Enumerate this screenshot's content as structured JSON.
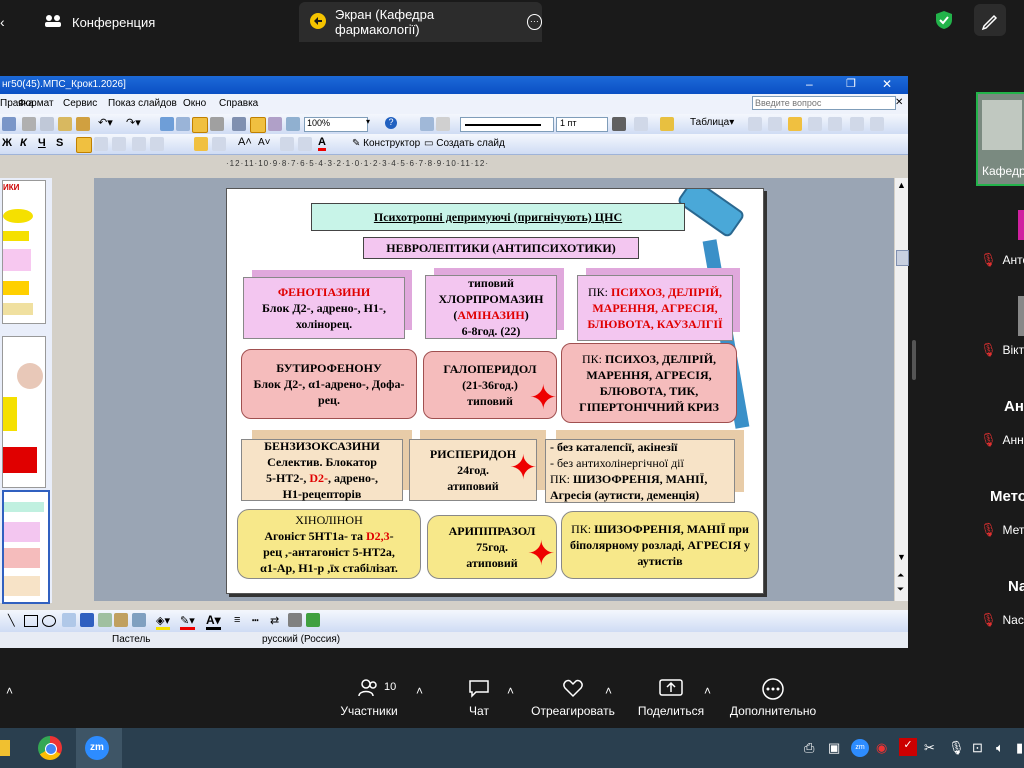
{
  "zoom_top": {
    "conference_tab": "Конференция",
    "screen_tab": "Экран (Кафедра фармакології)"
  },
  "ppt": {
    "title": "нг50(45).МПС_Крок1.2026]",
    "menu": [
      "Правка",
      "Формат",
      "Сервис",
      "Показ слайдов",
      "Окно",
      "Справка"
    ],
    "help_placeholder": "Введите вопрос",
    "zoom_value": "100%",
    "line_width": "1 пт",
    "table_label": "Таблица",
    "designer_label": "Конструктор",
    "new_slide_label": "Создать слайд",
    "ruler": "·12·11·10·9·8·7·6·5·4·3·2·1·0·1·2·3·4·5·6·7·8·9·10·11·12·",
    "status_theme": "Пастель",
    "status_lang": "русский (Россия)"
  },
  "slide": {
    "title": "Психотропні депримуючі (пригнічують) ЦНС",
    "subtitle": "НЕВРОЛЕПТИКИ (АНТИПСИХОТИКИ)",
    "phenothiazines": {
      "name": "ФЕНОТІАЗИНИ",
      "desc": "Блок Д2-, адрено-, Н1-, холінорец."
    },
    "chlorpromazine": {
      "type": "типовий",
      "name": "ХЛОРПРОМАЗИН",
      "alias": "АМІНАЗИН",
      "dose": "6-8год. (22)"
    },
    "pk1": {
      "label": "ПК:",
      "text": "ПСИХОЗ, ДЕЛІРІЙ, МАРЕННЯ, АГРЕСІЯ, БЛЮВОТА, КАУЗАЛГІЇ"
    },
    "butyrophenone": {
      "name": "БУТИРОФЕНОНУ",
      "desc": "Блок Д2-, α1-адрено-, Дофа-рец."
    },
    "haloperidol": {
      "name": "ГАЛОПЕРИДОЛ",
      "dose": "(21-36год.)",
      "type": "типовий"
    },
    "pk2": {
      "label": "ПК:",
      "text": "ПСИХОЗ, ДЕЛІРІЙ, МАРЕННЯ, АГРЕСІЯ, БЛЮВОТА, ТИК, ГІПЕРТОНІЧНИЙ КРИЗ"
    },
    "benzisoxazines": {
      "name": "БЕНЗИЗОКСАЗИНИ",
      "desc1": "Селектив. Блокатор",
      "desc2": "5-НТ2-,",
      "desc2_red": "D2-",
      "desc2_end": ", адрено-,",
      "desc3": "Н1-рецепторів"
    },
    "risperidone": {
      "name": "РИСПЕРИДОН",
      "dose": "24год.",
      "type": "атиповий"
    },
    "pk3": {
      "line1": "- без каталепсії, акінезії",
      "line2": "- без антихолінергічної дії",
      "label": "ПК:",
      "text": "ШИЗОФРЕНІЯ, МАНІЇ,",
      "line4": "Агресія (аутисти, деменція)"
    },
    "quinolinone": {
      "name": "ХІНОЛІНОН",
      "desc1": "Агоніст 5НТ1а- та",
      "desc1_red": "D2,3",
      "desc1_end": "-",
      "desc2": "рец ,-антагоніст 5-НТ2а,",
      "desc3": "α1-Ар, Н1-р ,їх стабілізат."
    },
    "aripiprazole": {
      "name": "АРИПІПРАЗОЛ",
      "dose": "75год.",
      "type": "атиповий"
    },
    "pk4": {
      "label": "ПК:",
      "text": "ШИЗОФРЕНІЯ, МАНІЇ при біполярному розладі, АГРЕСІЯ у аутистів"
    }
  },
  "side_panel": {
    "video_label": "Кафедр",
    "participants": [
      "Анто",
      "Вікто",
      "Анн",
      "Мет",
      "Nас"
    ],
    "headers": [
      "Ан",
      "Мето",
      "Na"
    ]
  },
  "controls": {
    "participants_label": "Участники",
    "participants_count": "10",
    "chat_label": "Чат",
    "react_label": "Отреагировать",
    "share_label": "Поделиться",
    "more_label": "Дополнительно"
  }
}
